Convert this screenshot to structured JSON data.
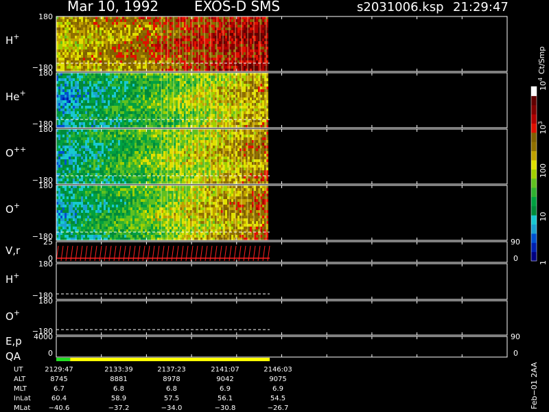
{
  "header": {
    "date": "Mar 10, 1992",
    "instrument": "EXOS-D SMS",
    "file": "s2031006.ksp",
    "time": "21:29:47"
  },
  "colorbar": {
    "label": "Ct/Smp",
    "ticks": [
      {
        "text": "10",
        "sup": "4",
        "value": 10000
      },
      {
        "text": "10",
        "sup": "3",
        "value": 1000
      },
      {
        "text": "100",
        "sup": "",
        "value": 100
      },
      {
        "text": "10",
        "sup": "",
        "value": 10
      },
      {
        "text": "1",
        "sup": "",
        "value": 1
      }
    ],
    "colors": [
      "#000080",
      "#0020b0",
      "#0050d0",
      "#1aa0d0",
      "#18c8d0",
      "#008a3a",
      "#00a040",
      "#30b030",
      "#60c020",
      "#a0d000",
      "#e0e000",
      "#c0a000",
      "#907000",
      "#806000",
      "#e01000",
      "#b00000",
      "#800000",
      "#600000",
      "#ffffff"
    ]
  },
  "chart_data": [
    {
      "type": "heatmap",
      "panel": "H+",
      "label": "H",
      "sup": "+",
      "ylim": [
        -180,
        180
      ],
      "ytick_top": "180",
      "ytick_bottom": "−180",
      "start_level": 0.6,
      "end_level": 0.9
    },
    {
      "type": "heatmap",
      "panel": "He+",
      "label": "He",
      "sup": "+",
      "ylim": [
        -180,
        180
      ],
      "ytick_top": "180",
      "ytick_bottom": "−180",
      "start_level": 0.22,
      "end_level": 0.68
    },
    {
      "type": "heatmap",
      "panel": "O++",
      "label": "O",
      "sup": "++",
      "ylim": [
        -180,
        180
      ],
      "ytick_top": "180",
      "ytick_bottom": "−180",
      "start_level": 0.25,
      "end_level": 0.72
    },
    {
      "type": "heatmap",
      "panel": "O+",
      "label": "O",
      "sup": "+",
      "ylim": [
        -180,
        180
      ],
      "ytick_top": "180",
      "ytick_bottom": "−180",
      "start_level": 0.25,
      "end_level": 0.75
    },
    {
      "type": "line",
      "panel": "V,r",
      "label": "V,r",
      "ytick_top": "25",
      "ytick_bottom": "0",
      "right_top": "90",
      "right_bottom": "0",
      "ylim": [
        0,
        25
      ]
    },
    {
      "type": "line",
      "panel": "H+ (lower)",
      "label": "H",
      "sup": "+",
      "ytick_top": "180",
      "ytick_bottom": "−180",
      "ylim": [
        -180,
        180
      ]
    },
    {
      "type": "line",
      "panel": "O+ (lower)",
      "label": "O",
      "sup": "+",
      "ytick_top": "180",
      "ytick_bottom": "−180",
      "ylim": [
        -180,
        180
      ]
    },
    {
      "type": "line",
      "panel": "E,p",
      "label": "E,p",
      "ytick_top": "4000",
      "ytick_bottom": "0",
      "right_top": "90",
      "right_bottom": "0",
      "ylim": [
        0,
        4000
      ]
    },
    {
      "type": "bar",
      "panel": "QA",
      "label": "QA",
      "segments": [
        {
          "from": 0,
          "to": 0.065,
          "color": "#22dd22"
        },
        {
          "from": 0.065,
          "to": 1,
          "color": "#ffff00"
        }
      ]
    }
  ],
  "time_axis": {
    "data_fraction": 0.473,
    "columns": [
      "2129:47",
      "2133:39",
      "2137:23",
      "2141:07",
      "2146:03"
    ],
    "rows": [
      {
        "name": "UT",
        "values": [
          "2129:47",
          "2133:39",
          "2137:23",
          "2141:07",
          "2146:03"
        ]
      },
      {
        "name": "ALT",
        "values": [
          "8745",
          "8881",
          "8978",
          "9042",
          "9075"
        ]
      },
      {
        "name": "MLT",
        "values": [
          "6.7",
          "6.8",
          "6.8",
          "6.9",
          "6.9"
        ]
      },
      {
        "name": "InLat",
        "values": [
          "60.4",
          "58.9",
          "57.5",
          "56.1",
          "54.5"
        ]
      },
      {
        "name": "MLat",
        "values": [
          "−40.6",
          "−37.2",
          "−34.0",
          "−30.8",
          "−26.7"
        ]
      }
    ]
  },
  "footer": {
    "stamp": "Feb−01 2AA"
  }
}
